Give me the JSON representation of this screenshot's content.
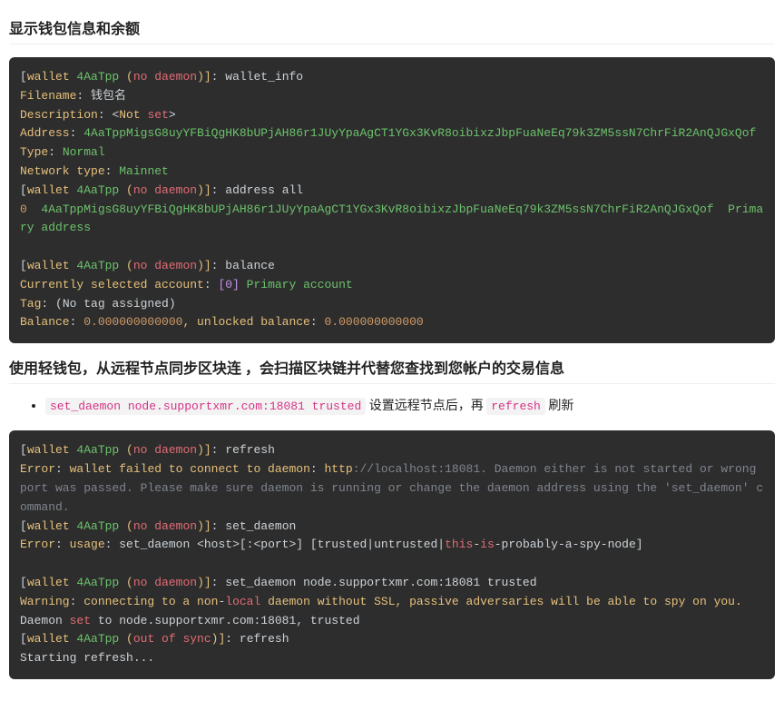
{
  "section1": {
    "heading": "显示钱包信息和余额",
    "code": {
      "wallet_short": "4AaTpp",
      "no_daemon": "no daemon",
      "out_of_sync": "out of sync",
      "cmd_wallet_info": "wallet_info",
      "filename_label": "Filename",
      "filename_value": "钱包名",
      "desc_label": "Description",
      "desc_lt": "<",
      "desc_not": "Not",
      "desc_set": "set",
      "desc_gt": ">",
      "addr_label": "Address",
      "address": "4AaTppMigsG8uyYFBiQgHK8bUPjAH86r1JUyYpaAgCT1YGx3KvR8oibixzJbpFuaNeEq79k3ZM5ssN7ChrFiR2AnQJGxQof",
      "type_label": "Type",
      "type_value": "Normal",
      "net_label": "Network type",
      "net_value": "Mainnet",
      "cmd_address_all": "address all",
      "idx0": "0",
      "primary_addr": "Primary address",
      "cmd_balance": "balance",
      "sel_acct_pre": "Currently selected account",
      "sel_idx": "[0]",
      "sel_primary": "Primary account",
      "tag_label": "Tag",
      "no_tag": "(No tag assigned)",
      "bal_label": "Balance",
      "bal_val": "0.000000000000",
      "unlocked_pre": ", unlocked balance",
      "unlocked_val": "0.000000000000"
    }
  },
  "section2": {
    "heading": "使用轻钱包，从远程节点同步区块连 ，会扫描区块链并代替您查找到您帐户的交易信息",
    "bullet": {
      "code1": "set_daemon node.supportxmr.com:18081 trusted",
      "text1": "设置远程节点后，再",
      "code2": "refresh",
      "text2": "刷新"
    },
    "code": {
      "cmd_refresh": "refresh",
      "err_label": "Error",
      "err1_a": "wallet failed to connect to daemon",
      "err1_b": "http",
      "err1_c": "://localhost:18081. Daemon either is not started or wrong port was passed. Please make sure daemon is running or change the daemon address using the 'set_daemon' command.",
      "cmd_set_daemon": "set_daemon",
      "err2_a": "usage",
      "err2_b": "set_daemon <host>[:<port>] [trusted|untrusted|",
      "err2_this": "this",
      "err2_dash": "-",
      "err2_is": "is",
      "err2_rest": "-probably-a-spy-node]",
      "cmd_sd_full": "set_daemon node.supportxmr.com:18081 trusted",
      "warn_label": "Warning",
      "warn_a": "connecting to a non",
      "warn_local": "local",
      "warn_b": "daemon without SSL, passive adversaries will be able to spy on you.",
      "daemon_set_a": "Daemon",
      "daemon_set_b": "set",
      "daemon_set_c": "to node.supportxmr.com:18081, trusted",
      "starting": "Starting refresh..."
    }
  }
}
